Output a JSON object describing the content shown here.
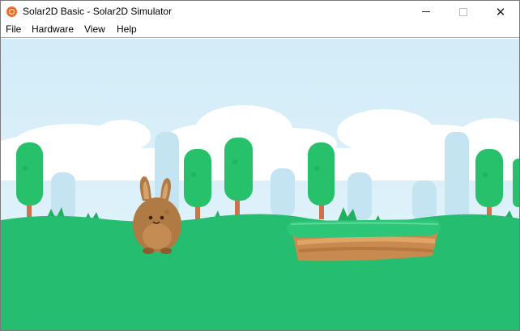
{
  "window": {
    "title": "Solar2D Basic - Solar2D Simulator",
    "app_icon": "solar2d-logo-icon",
    "controls": {
      "minimize_icon": "minimize-icon",
      "maximize_icon": "maximize-icon",
      "close_icon": "close-icon",
      "close_glyph": "✕"
    }
  },
  "menu": {
    "items": [
      {
        "label": "File"
      },
      {
        "label": "Hardware"
      },
      {
        "label": "View"
      },
      {
        "label": "Help"
      }
    ]
  },
  "game": {
    "colors": {
      "sky": "#d6eef9",
      "cloud": "#ffffff",
      "far_trees": "#cbe6f2",
      "tree_foliage": "#27c16b",
      "tree_trunk": "#c9744a",
      "ground": "#25bd6f",
      "platform_grass": "#2dc676",
      "platform_dirt": "#c88a4e",
      "bunny": "#b07a45"
    },
    "sprites": {
      "player": "bunny",
      "platform": "grass-dirt-platform",
      "trees": "bush-tree"
    }
  }
}
